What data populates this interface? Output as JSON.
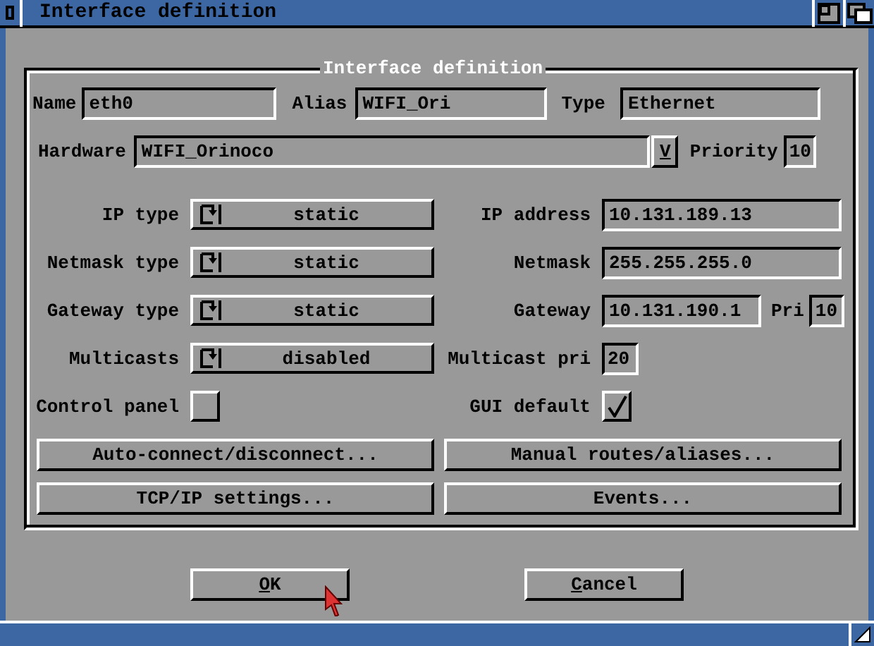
{
  "window": {
    "title": "Interface definition"
  },
  "group": {
    "title": "Interface definition"
  },
  "identity": [
    {
      "label": "Name",
      "value": "eth0"
    },
    {
      "label": "Alias",
      "value": "WIFI_Ori"
    },
    {
      "label": "Type",
      "value": "Ethernet"
    }
  ],
  "hardware": {
    "label": "Hardware",
    "value": "WIFI_Orinoco",
    "popup": "V",
    "priority_label": "Priority",
    "priority": "10"
  },
  "settings": [
    {
      "left": {
        "label": "IP type",
        "kind": "cycle",
        "value": "static"
      },
      "right": {
        "label": "IP address",
        "kind": "field",
        "value": "10.131.189.13"
      }
    },
    {
      "left": {
        "label": "Netmask type",
        "kind": "cycle",
        "value": "static"
      },
      "right": {
        "label": "Netmask",
        "kind": "field",
        "value": "255.255.255.0"
      }
    },
    {
      "left": {
        "label": "Gateway type",
        "kind": "cycle",
        "value": "static"
      },
      "right": {
        "label": "Gateway",
        "kind": "gateway",
        "value": "10.131.190.1",
        "pri_label": "Pri",
        "pri_value": "10"
      }
    },
    {
      "left": {
        "label": "Multicasts",
        "kind": "cycle",
        "value": "disabled"
      },
      "right": {
        "label": "Multicast pri",
        "kind": "small",
        "value": "20"
      }
    },
    {
      "left": {
        "label": "Control panel",
        "kind": "checkbox",
        "checked": false
      },
      "right": {
        "label": "GUI default",
        "kind": "checkbox",
        "checked": true
      }
    }
  ],
  "actions": [
    "Auto-connect/disconnect...",
    "Manual routes/aliases...",
    "TCP/IP settings...",
    "Events..."
  ],
  "buttons": [
    {
      "label": "OK",
      "hotkey_underlined": true
    },
    {
      "label": "Cancel",
      "hotkey_underlined": true
    }
  ]
}
